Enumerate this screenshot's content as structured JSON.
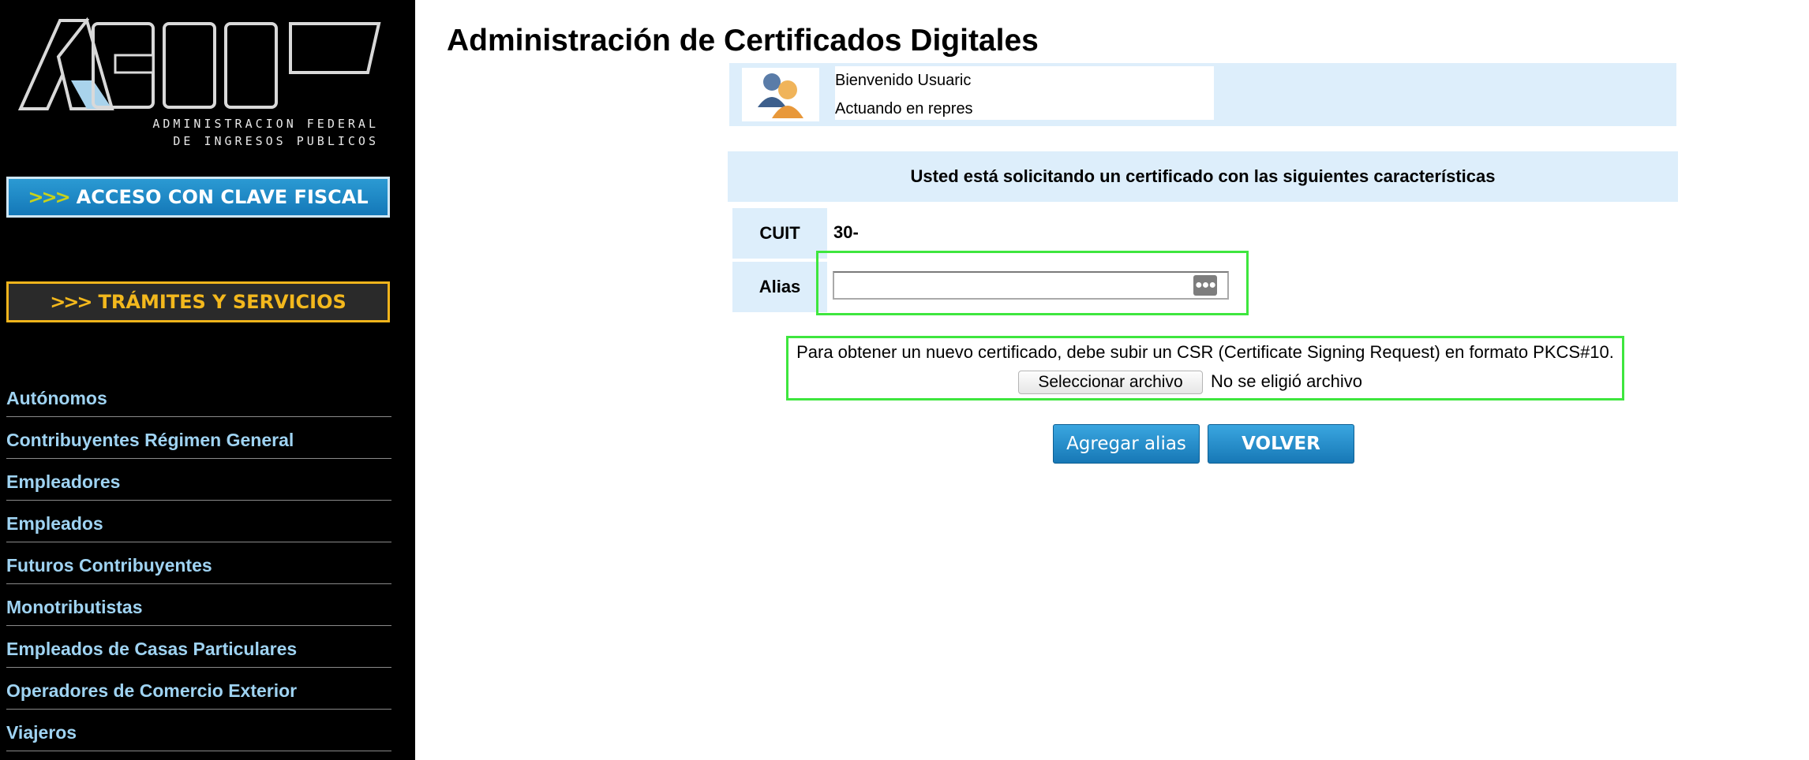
{
  "page": {
    "title": "Administración de Certificados Digitales"
  },
  "sidebar": {
    "logo_text": "AFIP",
    "logo_subtitle_line1": "ADMINISTRACION FEDERAL",
    "logo_subtitle_line2": "DE INGRESOS PUBLICOS",
    "clave_fiscal_button": {
      "chevrons": ">>>",
      "label": "ACCESO CON CLAVE FISCAL"
    },
    "tramites_button": {
      "chevrons": ">>>",
      "label": "TRÁMITES Y SERVICIOS"
    },
    "menu": [
      {
        "label": "Autónomos"
      },
      {
        "label": "Contribuyentes Régimen General"
      },
      {
        "label": "Empleadores"
      },
      {
        "label": "Empleados"
      },
      {
        "label": "Futuros Contribuyentes"
      },
      {
        "label": "Monotributistas"
      },
      {
        "label": "Empleados de Casas Particulares"
      },
      {
        "label": "Operadores de Comercio Exterior"
      },
      {
        "label": "Viajeros"
      }
    ]
  },
  "welcome": {
    "avatar_icon": "users-icon",
    "line1": "Bienvenido Usuaric",
    "line2": "Actuando en repres"
  },
  "request": {
    "header": "Usted está solicitando un certificado con las siguientes características",
    "cuit_label": "CUIT",
    "cuit_value": "30-",
    "alias_label": "Alias",
    "alias_value": "",
    "alias_addon_icon": "dots-icon"
  },
  "upload": {
    "instructions": "Para obtener un nuevo certificado, debe subir un CSR (Certificate Signing Request) en formato PKCS#10.",
    "file_button_label": "Seleccionar archivo",
    "file_status": "No se eligió archivo"
  },
  "actions": {
    "add_alias_label": "Agregar alias",
    "back_label": "VOLVER"
  },
  "colors": {
    "sidebar_bg": "#000000",
    "menu_link": "#9fd3f2",
    "panel_bg": "#ddeefb",
    "highlight": "#3ee63e",
    "button_blue": "#1778b6",
    "tramites_gold": "#f3b81d"
  }
}
